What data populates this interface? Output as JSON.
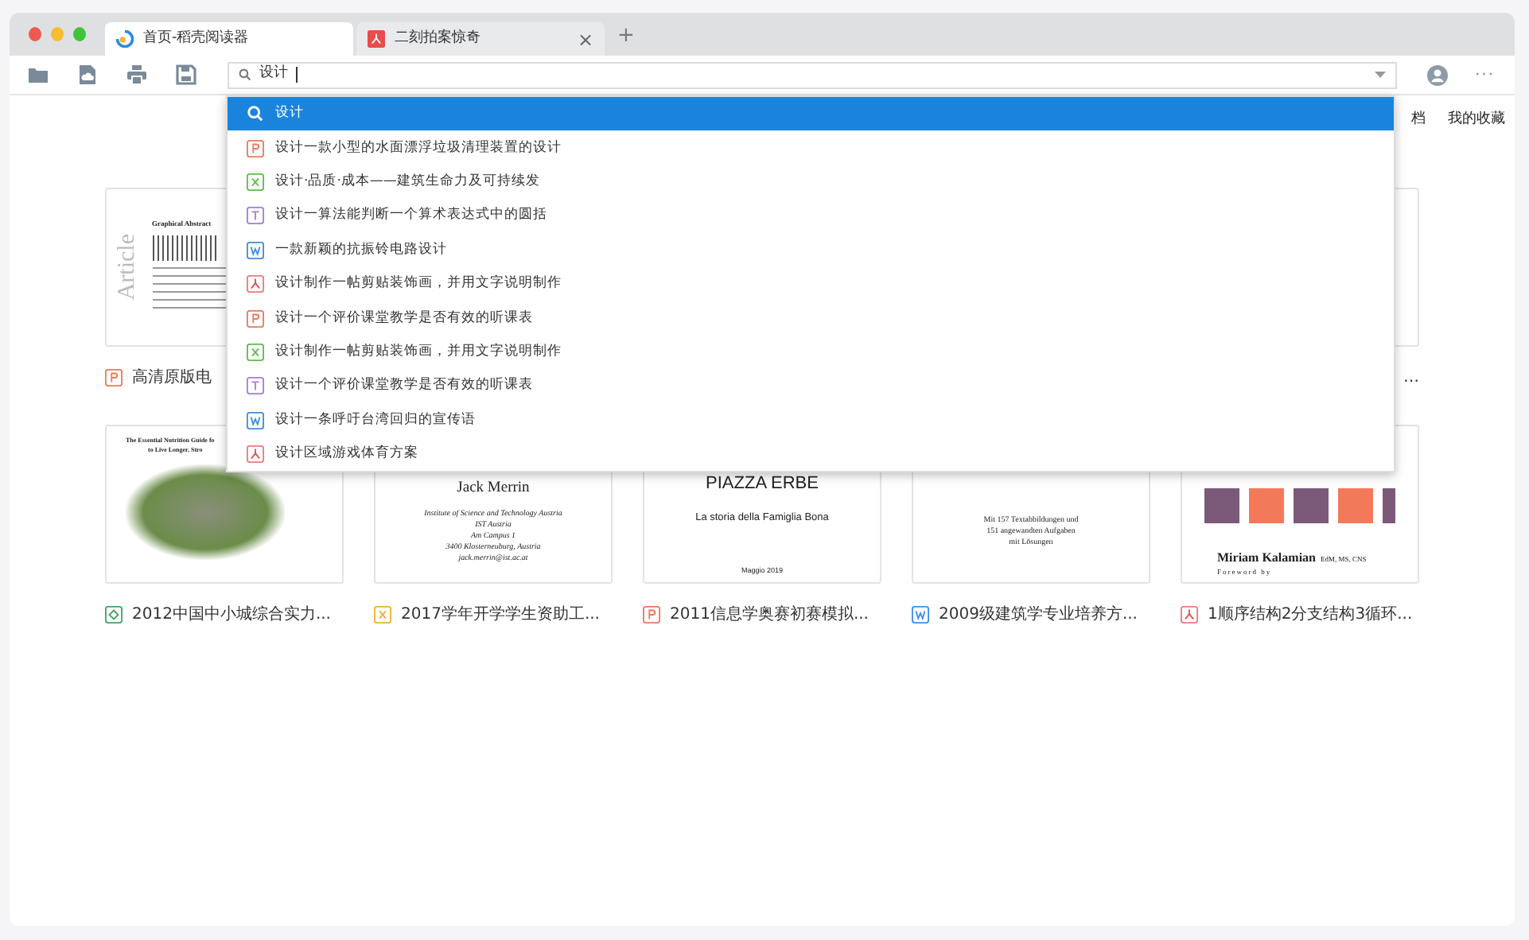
{
  "tabs": [
    {
      "label": "首页-稻壳阅读器",
      "kind": "home",
      "selected": true
    },
    {
      "label": "二刻拍案惊奇",
      "kind": "pdf",
      "selected": false,
      "close": "×"
    }
  ],
  "new_tab": "+",
  "search": {
    "value": "设计"
  },
  "menu_button": "···",
  "header_links": [
    "档",
    "我的收藏"
  ],
  "suggestions": [
    {
      "text": "设计",
      "kind": "search",
      "selected": true
    },
    {
      "text": "设计一款小型的水面漂浮垃圾清理装置的设计",
      "kind": "ppt",
      "selected": false
    },
    {
      "text": "设计·品质·成本——建筑生命力及可持续发",
      "kind": "xls",
      "selected": false
    },
    {
      "text": "设计一算法能判断一个算术表达式中的圆括",
      "kind": "txt",
      "selected": false
    },
    {
      "text": "一款新颖的抗振铃电路设计",
      "kind": "doc",
      "selected": false
    },
    {
      "text": "设计制作一帖剪贴装饰画，并用文字说明制作",
      "kind": "pdf",
      "selected": false
    },
    {
      "text": "设计一个评价课堂教学是否有效的听课表",
      "kind": "ppt",
      "selected": false
    },
    {
      "text": "设计制作一帖剪贴装饰画，并用文字说明制作",
      "kind": "xls",
      "selected": false
    },
    {
      "text": "设计一个评价课堂教学是否有效的听课表",
      "kind": "txt",
      "selected": false
    },
    {
      "text": "设计一条呼吁台湾回归的宣传语",
      "kind": "doc",
      "selected": false
    },
    {
      "text": "设计区域游戏体育方案",
      "kind": "pdf",
      "selected": false
    }
  ],
  "document_rows": [
    [
      {
        "title": "高清原版电",
        "kind": "ppt",
        "cover": {
          "kind": "article",
          "texts": [
            "Graphical Abstract",
            "Article"
          ]
        }
      },
      {
        "title": "…"
      }
    ],
    [
      {
        "title": "2012中国中小城综合实力...",
        "kind": "epub",
        "cover": {
          "kind": "photo",
          "texts": [
            "The Essential Nutrition Guide fo",
            "to Live Longer, Stro"
          ]
        }
      },
      {
        "title": "2017学年开学学生资助工...",
        "kind": "et",
        "cover": {
          "kind": "author",
          "texts": [
            "Jack Merrin",
            "Institute of Science and Technology Austria",
            "IST Austria",
            "Am Campus 1",
            "3400 Klosterneuburg, Austria",
            "jack.merrin@ist.ac.at"
          ]
        }
      },
      {
        "title": "2011信息学奥赛初赛模拟...",
        "kind": "ppt",
        "cover": {
          "kind": "title",
          "texts": [
            "PIAZZA ERBE",
            "La storia della Famiglia Bona",
            "Maggio 2019"
          ]
        }
      },
      {
        "title": "2009级建筑学专业培养方...",
        "kind": "doc",
        "cover": {
          "kind": "german",
          "texts": [
            "Mit 157 Textabbildungen und",
            "151 angewandten Aufgaben",
            "mit Lösungen"
          ]
        }
      },
      {
        "title": "1顺序结构2分支结构3循环...",
        "kind": "pdf",
        "cover": {
          "kind": "food",
          "texts": [
            "Miriam Kalamian",
            "EdM, MS, CNS",
            "Foreword by"
          ]
        }
      }
    ]
  ]
}
